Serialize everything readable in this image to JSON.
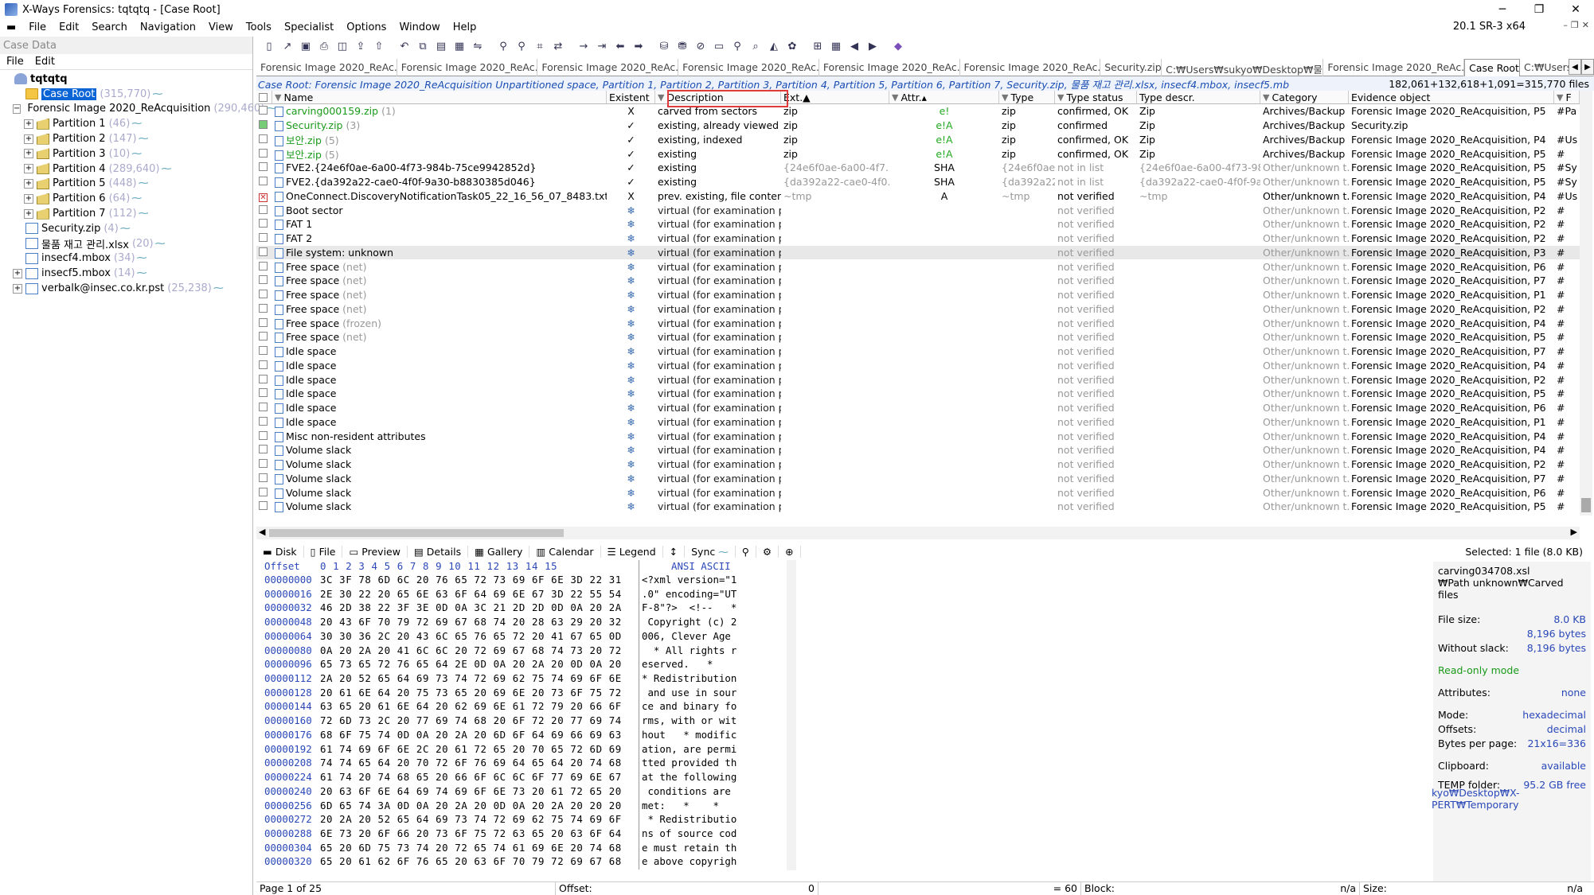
{
  "window": {
    "title": "X-Ways Forensics: tqtqtq - [Case Root]",
    "minimize": "─",
    "restore": "❐",
    "close": "✕"
  },
  "menu": [
    "File",
    "Edit",
    "Search",
    "Navigation",
    "View",
    "Tools",
    "Specialist",
    "Options",
    "Window",
    "Help"
  ],
  "version": "20.1 SR-3 x64",
  "left": {
    "header": "Case Data",
    "menu": [
      "File",
      "Edit"
    ],
    "tree": [
      {
        "label": "tqtqtq",
        "count": "",
        "indent": 0,
        "icon": "root",
        "exp": "none",
        "bold": true
      },
      {
        "label": "Case Root",
        "count": "(315,770)",
        "indent": 1,
        "icon": "folder",
        "exp": "none",
        "selected": true
      },
      {
        "label": "Forensic Image 2020_ReAcquisition",
        "count": "(290,460)",
        "indent": 1,
        "icon": "disk",
        "exp": "−"
      },
      {
        "label": "Partition 1",
        "count": "(46)",
        "indent": 2,
        "icon": "part",
        "exp": "+"
      },
      {
        "label": "Partition 2",
        "count": "(147)",
        "indent": 2,
        "icon": "part",
        "exp": "+"
      },
      {
        "label": "Partition 3",
        "count": "(10)",
        "indent": 2,
        "icon": "part",
        "exp": "+"
      },
      {
        "label": "Partition 4",
        "count": "(289,640)",
        "indent": 2,
        "icon": "part",
        "exp": "+"
      },
      {
        "label": "Partition 5",
        "count": "(448)",
        "indent": 2,
        "icon": "part",
        "exp": "+"
      },
      {
        "label": "Partition 6",
        "count": "(64)",
        "indent": 2,
        "icon": "part",
        "exp": "+"
      },
      {
        "label": "Partition 7",
        "count": "(112)",
        "indent": 2,
        "icon": "part",
        "exp": "+"
      },
      {
        "label": "Security.zip",
        "count": "(4)",
        "indent": 1,
        "icon": "file",
        "exp": "none"
      },
      {
        "label": "물품 재고 관리.xlsx",
        "count": "(20)",
        "indent": 1,
        "icon": "file",
        "exp": "none"
      },
      {
        "label": "insecf4.mbox",
        "count": "(34)",
        "indent": 1,
        "icon": "file",
        "exp": "none"
      },
      {
        "label": "insecf5.mbox",
        "count": "(14)",
        "indent": 1,
        "icon": "file",
        "exp": "+"
      },
      {
        "label": "verbalk@insec.co.kr.pst",
        "count": "(25,238)",
        "indent": 1,
        "icon": "file",
        "exp": "+"
      }
    ]
  },
  "toolbar_icons": [
    "new-case-icon",
    "open-icon",
    "save-icon",
    "print-icon",
    "properties-icon",
    "export-icon",
    "add-icon",
    "undo-icon",
    "copy-icon",
    "paste-icon",
    "fill-icon",
    "compare-icon",
    "binoculars-icon",
    "find-hex-icon",
    "hex-icon",
    "replace-icon",
    "arrow-right-icon",
    "goto-icon",
    "back-icon",
    "forward-icon",
    "disk-image-icon",
    "clone-icon",
    "wipe-icon",
    "monitor-icon",
    "zoom-icon",
    "search-icon",
    "chart-icon",
    "settings-icon",
    "grid-icon",
    "table-icon",
    "prev-icon",
    "next-icon",
    "gem-icon"
  ],
  "tabs": [
    "Forensic Image 2020_ReAc...",
    "Forensic Image 2020_ReAc...",
    "Forensic Image 2020_ReAc...",
    "Forensic Image 2020_ReAc...",
    "Forensic Image 2020_ReAc...",
    "Forensic Image 2020_ReAc...",
    "Security.zip",
    "C:₩Users₩sukyo₩Desktop₩물...",
    "Forensic Image 2020_ReAc...",
    "Case Root",
    "C:₩Users₩sukyo"
  ],
  "active_tab": 9,
  "pathbar": {
    "path": "Case Root: Forensic Image 2020_ReAcquisition Unpartitioned space, Partition 1, Partition 2, Partition 3, Partition 4, Partition 5, Partition 6, Partition 7, Security.zip, 물품 재고 관리.xlsx, insecf4.mbox, insecf5.mb",
    "count": "182,061+132,618+1,091=315,770 files"
  },
  "columns": [
    "Name",
    "Existent",
    "Description",
    "Ext.",
    "Attr.",
    "Type",
    "Type status",
    "Type descr.",
    "Category",
    "Evidence object",
    "F"
  ],
  "rows": [
    {
      "name": "carving000159.zip",
      "cnt": "(1)",
      "nc": "green",
      "ex": "X",
      "desc": "carved from sectors",
      "ext": "zip",
      "attr": "e!",
      "type": "zip",
      "ts": "confirmed, OK",
      "td": "Zip",
      "cat": "Archives/Backup",
      "ev": "Forensic Image 2020_ReAcquisition, P5",
      "p": "#Pa",
      "chk": ""
    },
    {
      "name": "Security.zip",
      "cnt": "(3)",
      "nc": "green",
      "ex": "✓",
      "desc": "existing, already viewed",
      "ext": "zip",
      "attr": "e!A",
      "type": "zip",
      "ts": "confirmed",
      "td": "Zip",
      "cat": "Archives/Backup",
      "ev": "Security.zip",
      "p": "",
      "chk": "g"
    },
    {
      "name": "보안.zip",
      "cnt": "(5)",
      "nc": "green",
      "ex": "✓",
      "desc": "existing, indexed",
      "ext": "zip",
      "attr": "e!A",
      "type": "zip",
      "ts": "confirmed, OK",
      "td": "Zip",
      "cat": "Archives/Backup",
      "ev": "Forensic Image 2020_ReAcquisition, P4",
      "p": "#Us",
      "chk": ""
    },
    {
      "name": "보안.zip",
      "cnt": "(5)",
      "nc": "green",
      "ex": "✓",
      "desc": "existing",
      "ext": "zip",
      "attr": "e!A",
      "type": "zip",
      "ts": "confirmed, OK",
      "td": "Zip",
      "cat": "Archives/Backup",
      "ev": "Forensic Image 2020_ReAcquisition, P5",
      "p": "#",
      "chk": ""
    },
    {
      "name": "FVE2.{24e6f0ae-6a00-4f73-984b-75ce9942852d}",
      "cnt": "",
      "nc": "",
      "ex": "✓",
      "desc": "existing",
      "ext": "{24e6f0ae-6a00-4f7...",
      "attr": "SHA",
      "type": "{24e6f0ae...",
      "ts": "not in list",
      "td": "{24e6f0ae-6a00-4f73-98...",
      "cat": "Other/unknown t...",
      "ev": "Forensic Image 2020_ReAcquisition, P5",
      "p": "#Sy",
      "chk": ""
    },
    {
      "name": "FVE2.{da392a22-cae0-4f0f-9a30-b8830385d046}",
      "cnt": "",
      "nc": "",
      "ex": "✓",
      "desc": "existing",
      "ext": "{da392a22-cae0-4f0...",
      "attr": "SHA",
      "type": "{da392a22...",
      "ts": "not in list",
      "td": "{da392a22-cae0-4f0f-9a...",
      "cat": "Other/unknown t...",
      "ev": "Forensic Image 2020_ReAcquisition, P5",
      "p": "#Sy",
      "chk": ""
    },
    {
      "name": "OneConnect.DiscoveryNotificationTask05_22_16_56_07_8483.txt.~tmp",
      "cnt": "",
      "nc": "",
      "ex": "X",
      "desc": "prev. existing, file content...",
      "ext": "~tmp",
      "attr": "A",
      "type": "~tmp",
      "ts": "not verified",
      "td": "~tmp",
      "cat": "Other/unknown t...",
      "ev": "Forensic Image 2020_ReAcquisition, P4",
      "p": "#Us",
      "chk": "x"
    },
    {
      "name": "Boot sector",
      "cnt": "",
      "nc": "",
      "ex": "❄",
      "desc": "virtual (for examination p...",
      "ext": "",
      "attr": "",
      "type": "",
      "ts": "not verified",
      "td": "",
      "cat": "Other/unknown t...",
      "ev": "Forensic Image 2020_ReAcquisition, P2",
      "p": "#",
      "chk": ""
    },
    {
      "name": "FAT 1",
      "cnt": "",
      "nc": "",
      "ex": "❄",
      "desc": "virtual (for examination p...",
      "ext": "",
      "attr": "",
      "type": "",
      "ts": "not verified",
      "td": "",
      "cat": "Other/unknown t...",
      "ev": "Forensic Image 2020_ReAcquisition, P2",
      "p": "#",
      "chk": ""
    },
    {
      "name": "FAT 2",
      "cnt": "",
      "nc": "",
      "ex": "❄",
      "desc": "virtual (for examination p...",
      "ext": "",
      "attr": "",
      "type": "",
      "ts": "not verified",
      "td": "",
      "cat": "Other/unknown t...",
      "ev": "Forensic Image 2020_ReAcquisition, P2",
      "p": "#",
      "chk": ""
    },
    {
      "name": "File system: unknown",
      "cnt": "",
      "nc": "",
      "ex": "❄",
      "desc": "virtual (for examination p...",
      "ext": "",
      "attr": "",
      "type": "",
      "ts": "not verified",
      "td": "",
      "cat": "Other/unknown t...",
      "ev": "Forensic Image 2020_ReAcquisition, P3",
      "p": "#",
      "chk": ""
    },
    {
      "name": "Free space",
      "cnt": "(net)",
      "nc": "",
      "ex": "❄",
      "desc": "virtual (for examination p...",
      "ext": "",
      "attr": "",
      "type": "",
      "ts": "not verified",
      "td": "",
      "cat": "Other/unknown t...",
      "ev": "Forensic Image 2020_ReAcquisition, P6",
      "p": "#",
      "chk": ""
    },
    {
      "name": "Free space",
      "cnt": "(net)",
      "nc": "",
      "ex": "❄",
      "desc": "virtual (for examination p...",
      "ext": "",
      "attr": "",
      "type": "",
      "ts": "not verified",
      "td": "",
      "cat": "Other/unknown t...",
      "ev": "Forensic Image 2020_ReAcquisition, P7",
      "p": "#",
      "chk": ""
    },
    {
      "name": "Free space",
      "cnt": "(net)",
      "nc": "",
      "ex": "❄",
      "desc": "virtual (for examination p...",
      "ext": "",
      "attr": "",
      "type": "",
      "ts": "not verified",
      "td": "",
      "cat": "Other/unknown t...",
      "ev": "Forensic Image 2020_ReAcquisition, P1",
      "p": "#",
      "chk": ""
    },
    {
      "name": "Free space",
      "cnt": "(net)",
      "nc": "",
      "ex": "❄",
      "desc": "virtual (for examination p...",
      "ext": "",
      "attr": "",
      "type": "",
      "ts": "not verified",
      "td": "",
      "cat": "Other/unknown t...",
      "ev": "Forensic Image 2020_ReAcquisition, P2",
      "p": "#",
      "chk": ""
    },
    {
      "name": "Free space",
      "cnt": "(frozen)",
      "nc": "",
      "ex": "❄",
      "desc": "virtual (for examination p...",
      "ext": "",
      "attr": "",
      "type": "",
      "ts": "not verified",
      "td": "",
      "cat": "Other/unknown t...",
      "ev": "Forensic Image 2020_ReAcquisition, P4",
      "p": "#",
      "chk": ""
    },
    {
      "name": "Free space",
      "cnt": "(net)",
      "nc": "",
      "ex": "❄",
      "desc": "virtual (for examination p...",
      "ext": "",
      "attr": "",
      "type": "",
      "ts": "not verified",
      "td": "",
      "cat": "Other/unknown t...",
      "ev": "Forensic Image 2020_ReAcquisition, P5",
      "p": "#",
      "chk": ""
    },
    {
      "name": "Idle space",
      "cnt": "",
      "nc": "",
      "ex": "❄",
      "desc": "virtual (for examination p...",
      "ext": "",
      "attr": "",
      "type": "",
      "ts": "not verified",
      "td": "",
      "cat": "Other/unknown t...",
      "ev": "Forensic Image 2020_ReAcquisition, P7",
      "p": "#",
      "chk": ""
    },
    {
      "name": "Idle space",
      "cnt": "",
      "nc": "",
      "ex": "❄",
      "desc": "virtual (for examination p...",
      "ext": "",
      "attr": "",
      "type": "",
      "ts": "not verified",
      "td": "",
      "cat": "Other/unknown t...",
      "ev": "Forensic Image 2020_ReAcquisition, P4",
      "p": "#",
      "chk": ""
    },
    {
      "name": "Idle space",
      "cnt": "",
      "nc": "",
      "ex": "❄",
      "desc": "virtual (for examination p...",
      "ext": "",
      "attr": "",
      "type": "",
      "ts": "not verified",
      "td": "",
      "cat": "Other/unknown t...",
      "ev": "Forensic Image 2020_ReAcquisition, P2",
      "p": "#",
      "chk": ""
    },
    {
      "name": "Idle space",
      "cnt": "",
      "nc": "",
      "ex": "❄",
      "desc": "virtual (for examination p...",
      "ext": "",
      "attr": "",
      "type": "",
      "ts": "not verified",
      "td": "",
      "cat": "Other/unknown t...",
      "ev": "Forensic Image 2020_ReAcquisition, P5",
      "p": "#",
      "chk": ""
    },
    {
      "name": "Idle space",
      "cnt": "",
      "nc": "",
      "ex": "❄",
      "desc": "virtual (for examination p...",
      "ext": "",
      "attr": "",
      "type": "",
      "ts": "not verified",
      "td": "",
      "cat": "Other/unknown t...",
      "ev": "Forensic Image 2020_ReAcquisition, P6",
      "p": "#",
      "chk": ""
    },
    {
      "name": "Idle space",
      "cnt": "",
      "nc": "",
      "ex": "❄",
      "desc": "virtual (for examination p...",
      "ext": "",
      "attr": "",
      "type": "",
      "ts": "not verified",
      "td": "",
      "cat": "Other/unknown t...",
      "ev": "Forensic Image 2020_ReAcquisition, P1",
      "p": "#",
      "chk": ""
    },
    {
      "name": "Misc non-resident attributes",
      "cnt": "",
      "nc": "",
      "ex": "❄",
      "desc": "virtual (for examination p...",
      "ext": "",
      "attr": "",
      "type": "",
      "ts": "not verified",
      "td": "",
      "cat": "Other/unknown t...",
      "ev": "Forensic Image 2020_ReAcquisition, P4",
      "p": "#",
      "chk": ""
    },
    {
      "name": "Volume slack",
      "cnt": "",
      "nc": "",
      "ex": "❄",
      "desc": "virtual (for examination p...",
      "ext": "",
      "attr": "",
      "type": "",
      "ts": "not verified",
      "td": "",
      "cat": "Other/unknown t...",
      "ev": "Forensic Image 2020_ReAcquisition, P4",
      "p": "#",
      "chk": ""
    },
    {
      "name": "Volume slack",
      "cnt": "",
      "nc": "",
      "ex": "❄",
      "desc": "virtual (for examination p...",
      "ext": "",
      "attr": "",
      "type": "",
      "ts": "not verified",
      "td": "",
      "cat": "Other/unknown t...",
      "ev": "Forensic Image 2020_ReAcquisition, P2",
      "p": "#",
      "chk": ""
    },
    {
      "name": "Volume slack",
      "cnt": "",
      "nc": "",
      "ex": "❄",
      "desc": "virtual (for examination p...",
      "ext": "",
      "attr": "",
      "type": "",
      "ts": "not verified",
      "td": "",
      "cat": "Other/unknown t...",
      "ev": "Forensic Image 2020_ReAcquisition, P7",
      "p": "#",
      "chk": ""
    },
    {
      "name": "Volume slack",
      "cnt": "",
      "nc": "",
      "ex": "❄",
      "desc": "virtual (for examination p...",
      "ext": "",
      "attr": "",
      "type": "",
      "ts": "not verified",
      "td": "",
      "cat": "Other/unknown t...",
      "ev": "Forensic Image 2020_ReAcquisition, P6",
      "p": "#",
      "chk": ""
    },
    {
      "name": "Volume slack",
      "cnt": "",
      "nc": "",
      "ex": "❄",
      "desc": "virtual (for examination p...",
      "ext": "",
      "attr": "",
      "type": "",
      "ts": "not verified",
      "td": "",
      "cat": "Other/unknown t...",
      "ev": "Forensic Image 2020_ReAcquisition, P5",
      "p": "#",
      "chk": ""
    },
    {
      "name": "Volume slack",
      "cnt": "",
      "nc": "",
      "ex": "❄",
      "desc": "virtual (for examination p...",
      "ext": "",
      "attr": "",
      "type": "",
      "ts": "not verified",
      "td": "",
      "cat": "Other/unknown t...",
      "ev": "Forensic Image 2020_ReAcquisition, P1",
      "p": "#",
      "chk": ""
    }
  ],
  "preview_tabs": [
    "Disk",
    "File",
    "Preview",
    "Details",
    "Gallery",
    "Calendar",
    "Legend",
    "↕",
    "Sync"
  ],
  "selected_info": "Selected: 1 file (8.0 KB)",
  "hex": {
    "header_offset": "Offset",
    "header_bytes": "0  1  2  3  4  5  6  7  8  9 10 11 12 13 14 15",
    "header_ascii": "ANSI ASCII",
    "rows": [
      {
        "o": "00000000",
        "b": "3C 3F 78 6D 6C 20 76 65 72 73 69 6F 6E 3D 22 31",
        "a": "<?xml version=\"1"
      },
      {
        "o": "00000016",
        "b": "2E 30 22 20 65 6E 63 6F 64 69 6E 67 3D 22 55 54",
        "a": ".0\" encoding=\"UT"
      },
      {
        "o": "00000032",
        "b": "46 2D 38 22 3F 3E 0D 0A 3C 21 2D 2D 0D 0A 20 2A",
        "a": "F-8\"?>  <!--   *"
      },
      {
        "o": "00000048",
        "b": "20 43 6F 70 79 72 69 67 68 74 20 28 63 29 20 32",
        "a": " Copyright (c) 2"
      },
      {
        "o": "00000064",
        "b": "30 30 36 2C 20 43 6C 65 76 65 72 20 41 67 65 0D",
        "a": "006, Clever Age "
      },
      {
        "o": "00000080",
        "b": "0A 20 2A 20 41 6C 6C 20 72 69 67 68 74 73 20 72",
        "a": "  * All rights r"
      },
      {
        "o": "00000096",
        "b": "65 73 65 72 76 65 64 2E 0D 0A 20 2A 20 0D 0A 20",
        "a": "eserved.   *    "
      },
      {
        "o": "00000112",
        "b": "2A 20 52 65 64 69 73 74 72 69 62 75 74 69 6F 6E",
        "a": "* Redistribution"
      },
      {
        "o": "00000128",
        "b": "20 61 6E 64 20 75 73 65 20 69 6E 20 73 6F 75 72",
        "a": " and use in sour"
      },
      {
        "o": "00000144",
        "b": "63 65 20 61 6E 64 20 62 69 6E 61 72 79 20 66 6F",
        "a": "ce and binary fo"
      },
      {
        "o": "00000160",
        "b": "72 6D 73 2C 20 77 69 74 68 20 6F 72 20 77 69 74",
        "a": "rms, with or wit"
      },
      {
        "o": "00000176",
        "b": "68 6F 75 74 0D 0A 20 2A 20 6D 6F 64 69 66 69 63",
        "a": "hout   * modific"
      },
      {
        "o": "00000192",
        "b": "61 74 69 6F 6E 2C 20 61 72 65 20 70 65 72 6D 69",
        "a": "ation, are permi"
      },
      {
        "o": "00000208",
        "b": "74 74 65 64 20 70 72 6F 76 69 64 65 64 20 74 68",
        "a": "tted provided th"
      },
      {
        "o": "00000224",
        "b": "61 74 20 74 68 65 20 66 6F 6C 6C 6F 77 69 6E 67",
        "a": "at the following"
      },
      {
        "o": "00000240",
        "b": "20 63 6F 6E 64 69 74 69 6F 6E 73 20 61 72 65 20",
        "a": " conditions are "
      },
      {
        "o": "00000256",
        "b": "6D 65 74 3A 0D 0A 20 2A 20 0D 0A 20 2A 20 20 20",
        "a": "met:   *    *   "
      },
      {
        "o": "00000272",
        "b": "20 2A 20 52 65 64 69 73 74 72 69 62 75 74 69 6F",
        "a": " * Redistributio"
      },
      {
        "o": "00000288",
        "b": "6E 73 20 6F 66 20 73 6F 75 72 63 65 20 63 6F 64",
        "a": "ns of source cod"
      },
      {
        "o": "00000304",
        "b": "65 20 6D 75 73 74 20 72 65 74 61 69 6E 20 74 68",
        "a": "e must retain th"
      },
      {
        "o": "00000320",
        "b": "65 20 61 62 6F 76 65 20 63 6F 70 79 72 69 67 68",
        "a": "e above copyrigh"
      }
    ]
  },
  "info": {
    "filename": "carving034708.xsl",
    "path": "₩Path unknown₩Carved files",
    "filesize_label": "File size:",
    "filesize_kb": "8.0 KB",
    "filesize_bytes": "8,196 bytes",
    "without_slack_label": "Without slack:",
    "without_slack": "8,196 bytes",
    "readonly": "Read-only mode",
    "attributes_label": "Attributes:",
    "attributes": "none",
    "mode_label": "Mode:",
    "mode": "hexadecimal",
    "offsets_label": "Offsets:",
    "offsets": "decimal",
    "bpp_label": "Bytes per page:",
    "bpp": "21x16=336",
    "clipboard_label": "Clipboard:",
    "clipboard": "available",
    "temp_label": "TEMP folder:",
    "temp": "95.2 GB free",
    "temp_path": "kyo₩Desktop₩X-PERT₩Temporary"
  },
  "status": {
    "page": "Page 1 of 25",
    "offset_label": "Offset:",
    "offset": "0",
    "eq": "= 60",
    "block_label": "Block:",
    "block": "n/a",
    "size_label": "Size:",
    "size": "n/a"
  }
}
